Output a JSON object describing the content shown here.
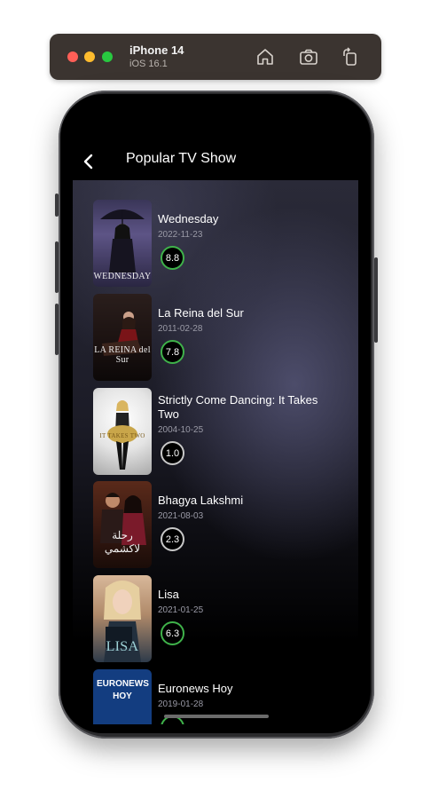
{
  "simulator": {
    "device": "iPhone 14",
    "os": "iOS 16.1",
    "buttons": [
      "home-icon",
      "screenshot-icon",
      "rotate-icon"
    ]
  },
  "nav": {
    "back_icon": "chevron-left-icon",
    "title": "Popular TV Show"
  },
  "shows": [
    {
      "title": "Wednesday",
      "date": "2022-11-23",
      "rating": "8.8",
      "poster_text": "WEDNESDAY",
      "poster_colors": [
        "#2c2a40",
        "#7b6f9c"
      ]
    },
    {
      "title": "La Reina del Sur",
      "date": "2011-02-28",
      "rating": "7.8",
      "poster_text": "LA REINA del Sur",
      "poster_colors": [
        "#1a1313",
        "#5a3a30"
      ]
    },
    {
      "title": "Strictly Come Dancing: It Takes Two",
      "date": "2004-10-25",
      "rating": "1.0",
      "poster_text": "IT TAKES TWO",
      "poster_colors": [
        "#f4f4f4",
        "#bcbcbc"
      ]
    },
    {
      "title": "Bhagya Lakshmi",
      "date": "2021-08-03",
      "rating": "2.3",
      "poster_text": "رحلة لاكشمي",
      "poster_colors": [
        "#3a1a12",
        "#8a4a2a"
      ]
    },
    {
      "title": "Lisa",
      "date": "2021-01-25",
      "rating": "6.3",
      "poster_text": "LISA",
      "poster_colors": [
        "#c9a586",
        "#3b4a5c"
      ]
    },
    {
      "title": "Euronews Hoy",
      "date": "2019-01-28",
      "rating": "",
      "poster_text": "EURONEWS HOY",
      "poster_colors": [
        "#0f3a7a",
        "#16407f"
      ]
    }
  ],
  "colors": {
    "rating_high": "#3fb24a",
    "rating_low": "#c8c8c8",
    "background": "#000000"
  }
}
